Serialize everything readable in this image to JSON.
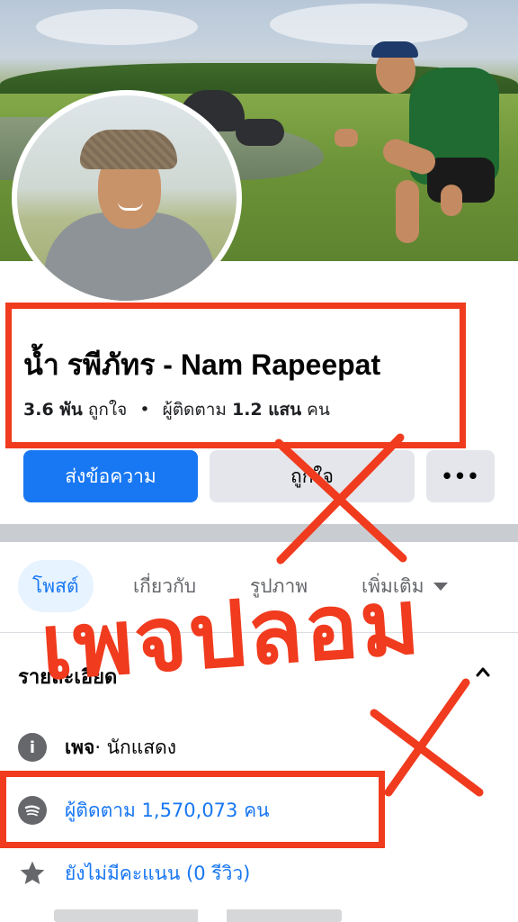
{
  "profile": {
    "name": "น้ำ รพีภัทร - Nam Rapeepat",
    "likes_count": "3.6 พัน",
    "likes_label": "ถูกใจ",
    "separator": "•",
    "followers_label": "ผู้ติดตาม",
    "followers_count": "1.2 แสน",
    "followers_unit": "คน"
  },
  "actions": {
    "message_label": "ส่งข้อความ",
    "like_label": "ถูกใจ",
    "more_label": "•••"
  },
  "tabs": [
    {
      "label": "โพสต์",
      "active": true
    },
    {
      "label": "เกี่ยวกับ",
      "active": false
    },
    {
      "label": "รูปภาพ",
      "active": false
    },
    {
      "label": "เพิ่มเติม",
      "active": false
    }
  ],
  "details": {
    "title": "รายละเอียด",
    "rows": [
      {
        "icon": "info-icon",
        "bold": "เพจ",
        "text": " · นักแสดง"
      },
      {
        "icon": "spotify-icon",
        "text": "ผู้ติดตาม 1,570,073 คน"
      },
      {
        "icon": "star-icon",
        "text": "ยังไม่มีคะแนน (0 รีวิว)"
      }
    ]
  },
  "overlay": {
    "stamp_text": "เพจปลอม",
    "mark_color": "#f03b1e"
  },
  "colors": {
    "brand_blue": "#1877f2",
    "secondary_button": "#e4e6eb",
    "annotation_red": "#f03b1e"
  }
}
